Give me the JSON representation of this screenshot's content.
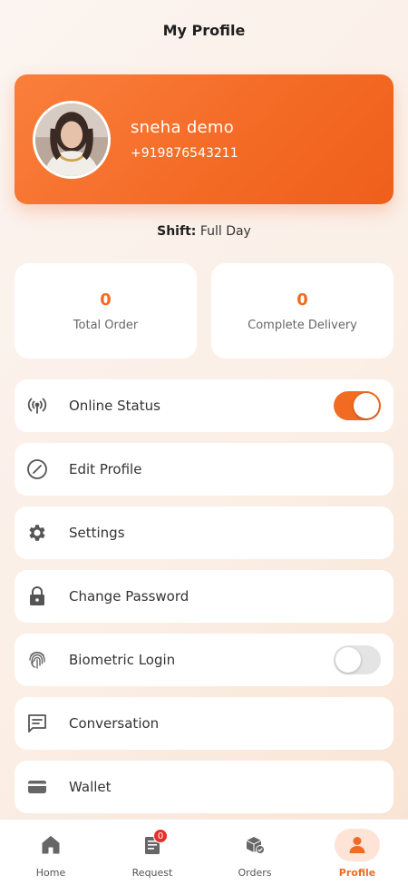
{
  "header": {
    "title": "My Profile"
  },
  "profile": {
    "name": "sneha demo",
    "phone": "+919876543211"
  },
  "shift": {
    "label": "Shift:",
    "value": "Full Day"
  },
  "stats": [
    {
      "value": "0",
      "label": "Total Order"
    },
    {
      "value": "0",
      "label": "Complete Delivery"
    }
  ],
  "menu": [
    {
      "label": "Online Status",
      "icon": "broadcast-icon",
      "toggle": true
    },
    {
      "label": "Edit Profile",
      "icon": "edit-icon"
    },
    {
      "label": "Settings",
      "icon": "gear-icon"
    },
    {
      "label": "Change Password",
      "icon": "lock-icon"
    },
    {
      "label": "Biometric Login",
      "icon": "fingerprint-icon",
      "toggle": false
    },
    {
      "label": "Conversation",
      "icon": "chat-icon"
    },
    {
      "label": "Wallet",
      "icon": "wallet-icon"
    }
  ],
  "nav": [
    {
      "label": "Home",
      "icon": "home-icon"
    },
    {
      "label": "Request",
      "icon": "request-icon",
      "badge": "0"
    },
    {
      "label": "Orders",
      "icon": "orders-icon"
    },
    {
      "label": "Profile",
      "icon": "profile-icon",
      "active": true
    }
  ],
  "colors": {
    "accent": "#f26b22",
    "card_gradient_start": "#fa7f3c",
    "card_gradient_end": "#ef5f1c",
    "badge": "#e5302b"
  }
}
